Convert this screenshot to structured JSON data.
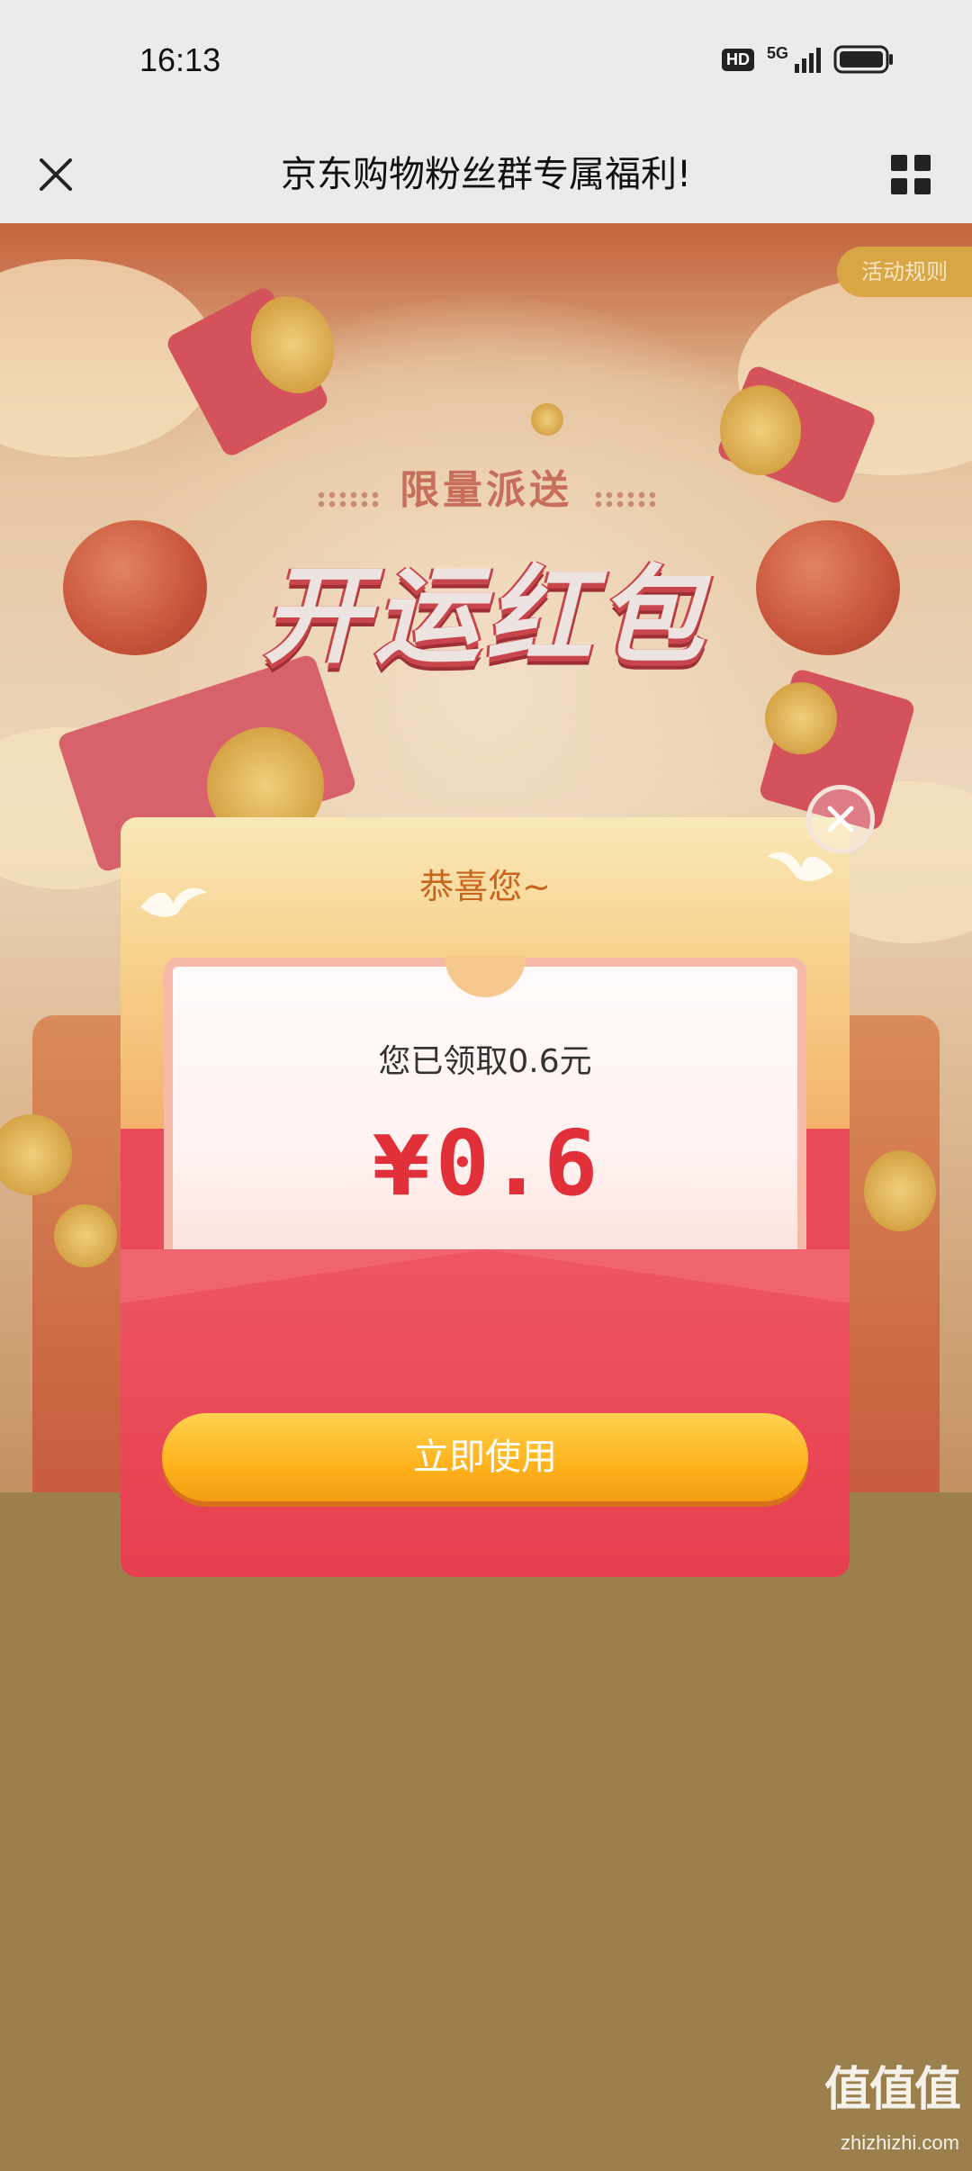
{
  "status_bar": {
    "time": "16:13",
    "hd": "HD",
    "network": "5G"
  },
  "nav": {
    "title": "京东购物粉丝群专属福利!"
  },
  "page": {
    "rules_label": "活动规则",
    "subtitle": "限量派送",
    "main_title": "开运红包"
  },
  "modal": {
    "header": "恭喜您~",
    "received_text": "您已领取0.6元",
    "currency_symbol": "¥",
    "amount": "0.6",
    "use_button": "立即使用"
  },
  "watermark": {
    "logo": "值值值",
    "url": "zhizhizhi.com"
  },
  "colors": {
    "status_bg": "#ebebeb",
    "overlay_bg": "#9b7f4d",
    "envelope_red": "#ea4a58",
    "amount_red": "#e2303b",
    "button_yellow": "#ffb21c",
    "header_orange": "#c9641e"
  }
}
